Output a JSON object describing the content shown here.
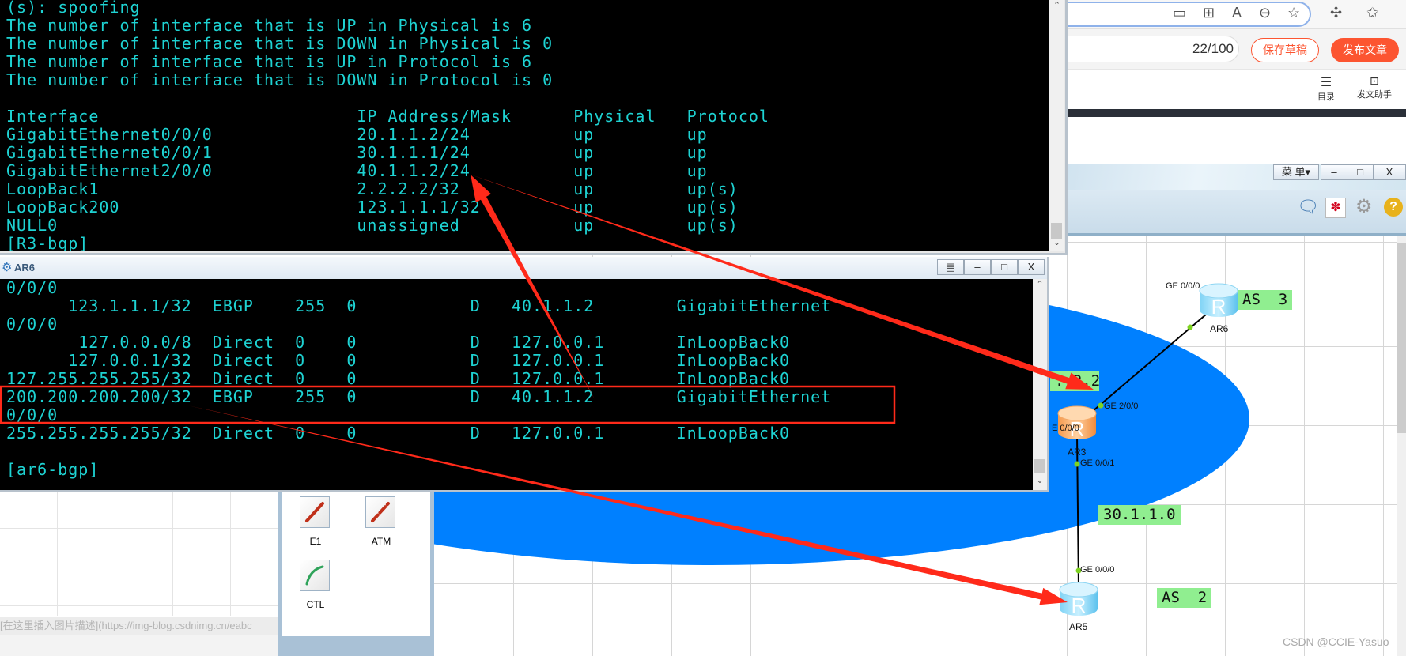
{
  "browser": {
    "address_icons": [
      "device-icon",
      "apps-icon",
      "read-aloud-icon",
      "zoom-out-icon",
      "add-favorite-icon"
    ],
    "extensions_icon": "puzzle-icon",
    "favorites_icon": "favorites-icon",
    "title_counter": "22/100",
    "save_draft": "保存草稿",
    "publish": "发布文章",
    "toc": "目录",
    "assistant": "发文助手",
    "accent": "#fc5531",
    "editor_placeholder": "[在这里插入图片描述](https://img-blog.csdnimg.cn/eabc"
  },
  "ensp": {
    "menu": "菜 单▾",
    "minimize": "–",
    "maximize": "□",
    "close": "X",
    "toolbar_icons": [
      "chat-icon",
      "huawei-logo-icon",
      "gear-icon",
      "help-icon"
    ],
    "palette": [
      {
        "label": "E1"
      },
      {
        "label": "ATM"
      },
      {
        "label": "CTL"
      }
    ],
    "topology": {
      "routers": [
        {
          "name": "AR6"
        },
        {
          "name": "AR3"
        },
        {
          "name": "AR5"
        }
      ],
      "ports": [
        "GE 0/0/0",
        "GE 2/0/0",
        "E 0/0/0",
        "GE 0/0/1",
        "GE 0/0/0"
      ],
      "labels": [
        "AS  3",
        "..2.2",
        "30.1.1.0",
        "AS  2"
      ],
      "region_color": "#0080ff"
    }
  },
  "r3_terminal": {
    "pre_lines": [
      "(s): spoofing",
      "The number of interface that is UP in Physical is 6",
      "The number of interface that is DOWN in Physical is 0",
      "The number of interface that is UP in Protocol is 6",
      "The number of interface that is DOWN in Protocol is 0"
    ],
    "headers": [
      "Interface",
      "IP Address/Mask",
      "Physical",
      "Protocol"
    ],
    "rows": [
      [
        "GigabitEthernet0/0/0",
        "20.1.1.2/24",
        "up",
        "up"
      ],
      [
        "GigabitEthernet0/0/1",
        "30.1.1.1/24",
        "up",
        "up"
      ],
      [
        "GigabitEthernet2/0/0",
        "40.1.1.2/24",
        "up",
        "up"
      ],
      [
        "LoopBack1",
        "2.2.2.2/32",
        "up",
        "up(s)"
      ],
      [
        "LoopBack200",
        "123.1.1.1/32",
        "up",
        "up(s)"
      ],
      [
        "NULL0",
        "unassigned",
        "up",
        "up(s)"
      ]
    ],
    "prompt": "[R3-bgp]"
  },
  "ar6_window": {
    "title": "AR6",
    "lines": [
      "0/0/0",
      [
        "123.1.1.1/32",
        "EBGP",
        "255",
        "0",
        "D",
        "40.1.1.2",
        "GigabitEthernet"
      ],
      "0/0/0",
      [
        "127.0.0.0/8",
        "Direct",
        "0",
        "0",
        "D",
        "127.0.0.1",
        "InLoopBack0"
      ],
      [
        "127.0.0.1/32",
        "Direct",
        "0",
        "0",
        "D",
        "127.0.0.1",
        "InLoopBack0"
      ],
      [
        "127.255.255.255/32",
        "Direct",
        "0",
        "0",
        "D",
        "127.0.0.1",
        "InLoopBack0"
      ],
      [
        "200.200.200.200/32",
        "EBGP",
        "255",
        "0",
        "D",
        "40.1.1.2",
        "GigabitEthernet"
      ],
      "0/0/0",
      [
        "255.255.255.255/32",
        "Direct",
        "0",
        "0",
        "D",
        "127.0.0.1",
        "InLoopBack0"
      ],
      "",
      "[ar6-bgp]"
    ]
  },
  "annotation_color": "#ff2a1a",
  "watermark": "CSDN @CCIE-Yasuo"
}
